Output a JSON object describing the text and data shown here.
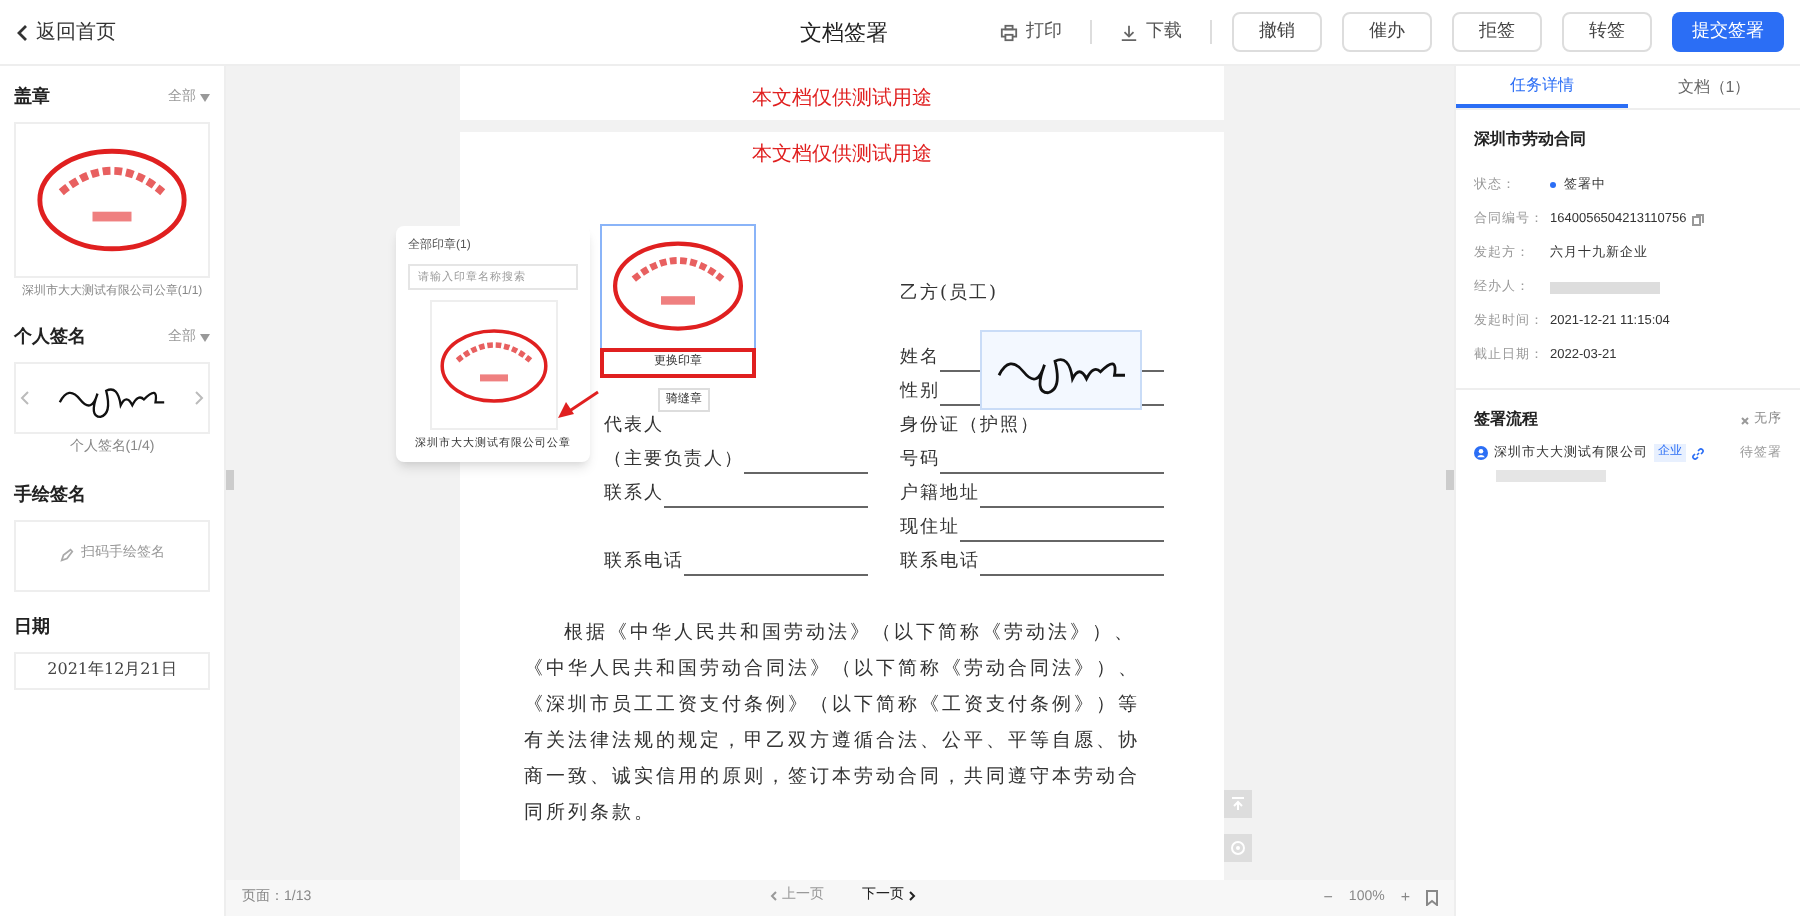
{
  "header": {
    "back": "返回首页",
    "title": "文档签署",
    "tools": [
      {
        "kind": "print",
        "label": "打印"
      },
      {
        "kind": "download",
        "label": "下载"
      }
    ],
    "buttons": [
      {
        "label": "撤销",
        "kind": "default"
      },
      {
        "label": "催办",
        "kind": "default"
      },
      {
        "label": "拒签",
        "kind": "default"
      },
      {
        "label": "转签",
        "kind": "default"
      },
      {
        "label": "提交签署",
        "kind": "primary"
      }
    ]
  },
  "sidebar": {
    "seal": {
      "title": "盖章",
      "filter": "全部",
      "caption": "深圳市大大测试有限公司公章(1/1)"
    },
    "signature": {
      "title": "个人签名",
      "filter": "全部",
      "caption": "个人签名(1/4)"
    },
    "handwritten": {
      "title": "手绘签名",
      "action": "扫码手绘签名"
    },
    "date": {
      "title": "日期",
      "value": "2021年12月21日"
    }
  },
  "document": {
    "watermark_lines": [
      "本文档仅供测试用途",
      "本文档仅供测试用途"
    ],
    "placed_seal": {
      "replace": "更换印章",
      "secondary": "骑缝章"
    },
    "party_b": "乙方(员工)",
    "rows": [
      {
        "right": {
          "label": "姓名",
          "kind": "blank"
        }
      },
      {
        "right": {
          "label": "性别",
          "kind": "blank"
        }
      },
      {
        "left": {
          "label": "代表人",
          "kind": "plain"
        },
        "right": {
          "label": "身份证（护照）",
          "kind": "plain"
        }
      },
      {
        "left": {
          "label": "（主要负责人）",
          "kind": "blank"
        },
        "right": {
          "label": "号码",
          "kind": "blank"
        }
      },
      {
        "left": {
          "label": "联系人",
          "kind": "blank"
        },
        "right": {
          "label": "户籍地址",
          "kind": "blank"
        }
      },
      {
        "right": {
          "label": "现住址",
          "kind": "blank"
        }
      },
      {
        "left": {
          "label": "联系电话",
          "kind": "blank"
        },
        "right": {
          "label": "联系电话",
          "kind": "blank"
        }
      }
    ],
    "paragraph": "根据《中华人民共和国劳动法》（以下简称《劳动法》）、《中华人民共和国劳动合同法》（以下简称《劳动合同法》）、《深圳市员工工资支付条例》（以下简称《工资支付条例》）等有关法律法规的规定，甲乙双方遵循合法、公平、平等自愿、协商一致、诚实信用的原则，签订本劳动合同，共同遵守本劳动合同所列条款。"
  },
  "seal_popup": {
    "title": "全部印章(1)",
    "placeholder": "请输入印章名称搜索",
    "caption": "深圳市大大测试有限公司公章"
  },
  "footer": {
    "page": "页面：1/13",
    "prev": {
      "label": "上一页",
      "disabled": true
    },
    "next": {
      "label": "下一页",
      "disabled": false
    },
    "zoom": "100%",
    "minus": "−",
    "plus": "+"
  },
  "panel": {
    "tabs": [
      {
        "label": "任务详情",
        "selected": true
      },
      {
        "label": "文档（1）",
        "selected": false
      }
    ],
    "contract_title": "深圳市劳动合同",
    "fields": [
      {
        "kind": "status",
        "label": "状态：",
        "value": "签署中",
        "color": "#2b6ef5"
      },
      {
        "kind": "copy",
        "label": "合同编号：",
        "value": "1640056504213110756"
      },
      {
        "kind": "text",
        "label": "发起方：",
        "value": "六月十九新企业"
      },
      {
        "kind": "hidden",
        "label": "经办人："
      },
      {
        "kind": "text",
        "label": "发起时间：",
        "value": "2021-12-21 11:15:04"
      },
      {
        "kind": "text",
        "label": "截止日期：",
        "value": "2022-03-21"
      }
    ],
    "flow": {
      "title": "签署流程",
      "order": "无序",
      "signers": [
        {
          "name": "深圳市大大测试有限公司",
          "tag": "企业",
          "status": "待签署"
        }
      ]
    }
  }
}
